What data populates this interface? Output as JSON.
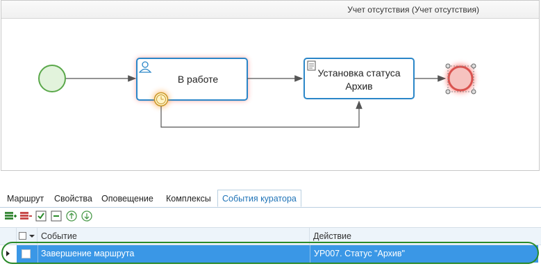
{
  "diagram": {
    "title": "Учет отсутствия (Учет отсутствия)",
    "task_in_work": {
      "label": "В работе",
      "icon": "user-icon"
    },
    "task_archive": {
      "label_line1": "Установка статуса",
      "label_line2": "Архив",
      "icon": "script-icon"
    },
    "timer_icon": "timer-icon",
    "colors": {
      "start": "#5aa84a",
      "end": "#d9534f",
      "task_border": "#2a86c8",
      "glow": "#ff3b30",
      "flow": "#555555"
    }
  },
  "tabs": [
    {
      "label": "Маршрут"
    },
    {
      "label": "Свойства"
    },
    {
      "label": "Оповещение"
    },
    {
      "label": "Комплексы"
    },
    {
      "label": "События куратора",
      "active": true
    }
  ],
  "toolbar": [
    {
      "name": "add-row-icon"
    },
    {
      "name": "delete-row-icon"
    },
    {
      "name": "check-all-icon"
    },
    {
      "name": "uncheck-all-icon"
    },
    {
      "name": "move-up-icon"
    },
    {
      "name": "move-down-icon"
    }
  ],
  "grid": {
    "headers": {
      "event": "Событие",
      "action": "Действие"
    },
    "rows": [
      {
        "event": "Завершение маршрута",
        "action": "УР007. Статус \"Архив\""
      }
    ]
  }
}
